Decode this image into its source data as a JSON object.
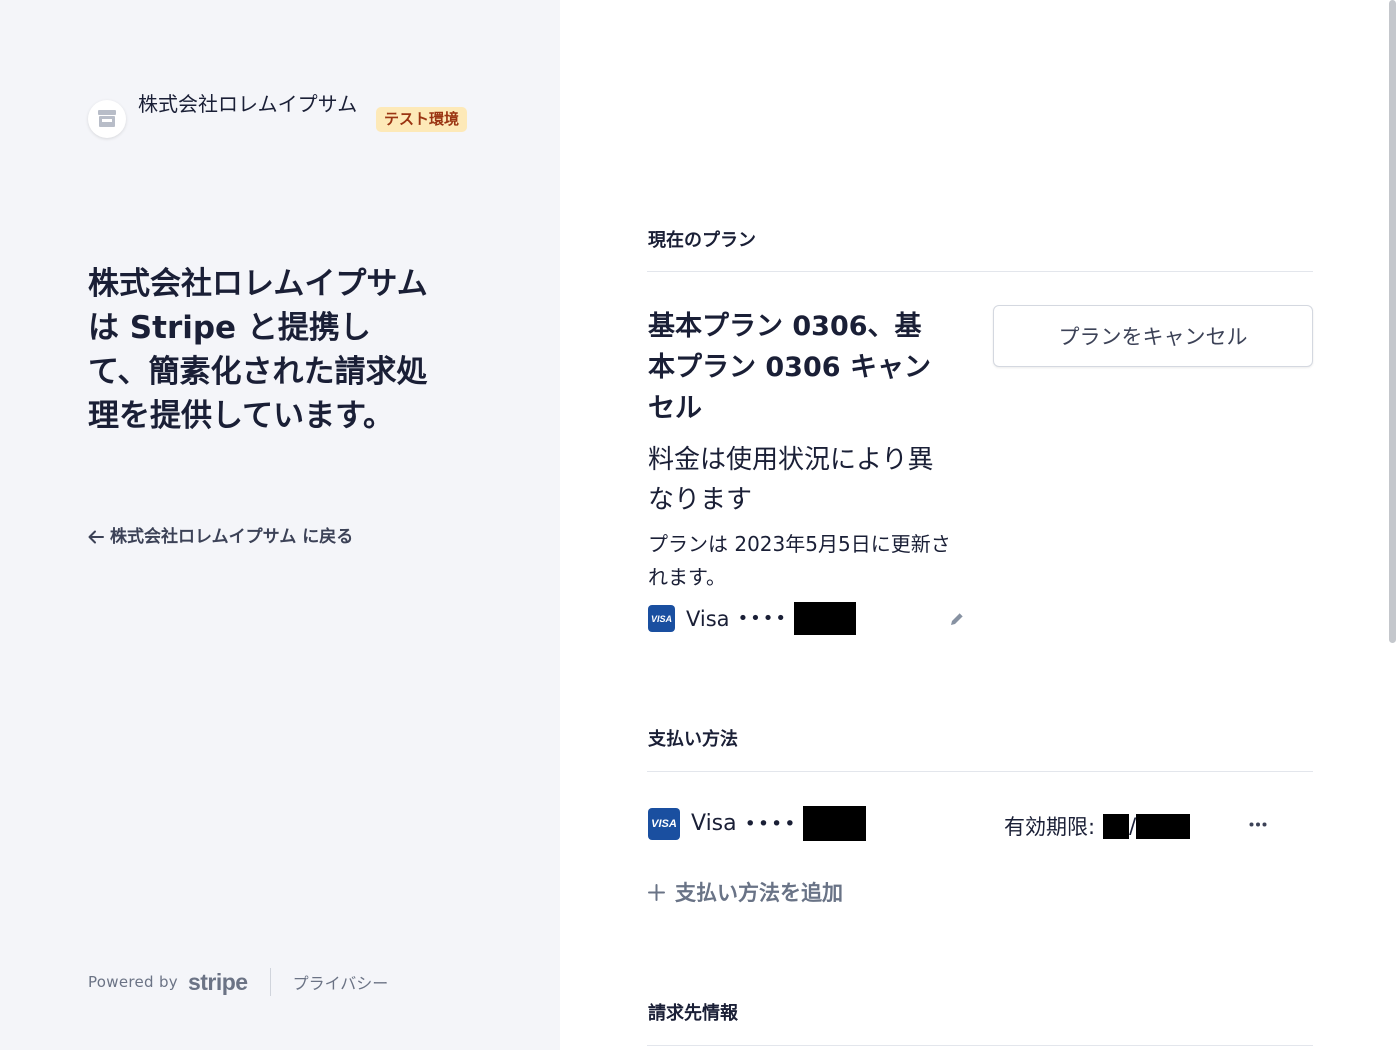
{
  "brand": {
    "name": "株式会社ロレムイプサム",
    "test_badge": "テスト環境"
  },
  "headline": "株式会社ロレムイプサム は Stripe と提携して、簡素化された請求処理を提供しています。",
  "back_link": "株式会社ロレムイプサム に戻る",
  "footer": {
    "powered_by": "Powered by",
    "stripe": "stripe",
    "privacy": "プライバシー"
  },
  "current_plan": {
    "section_title": "現在のプラン",
    "plan_name": "基本プラン 0306、基本プラン 0306 キャンセル",
    "price_text": "料金は使用状況により異なります",
    "renewal_text": "プランは 2023年5月5日に更新されます。",
    "card_brand": "Visa",
    "card_dots": "••••",
    "cancel_button": "プランをキャンセル"
  },
  "payment_methods": {
    "section_title": "支払い方法",
    "card_brand": "Visa",
    "card_dots": "••••",
    "expiry_label": "有効期限:",
    "expiry_sep": "/",
    "add_method": "支払い方法を追加"
  },
  "billing": {
    "section_title": "請求先情報"
  },
  "icons": {
    "brand": "store-icon",
    "back": "arrow-left-icon",
    "edit": "pencil-icon",
    "more": "ellipsis-icon",
    "add": "plus-icon",
    "card": "visa-icon"
  },
  "colors": {
    "left_panel_bg": "#f4f5f9",
    "badge_bg": "#fde9b8",
    "badge_text": "#9a3412",
    "visa_blue": "#1a4fa0",
    "muted_text": "#697386"
  }
}
